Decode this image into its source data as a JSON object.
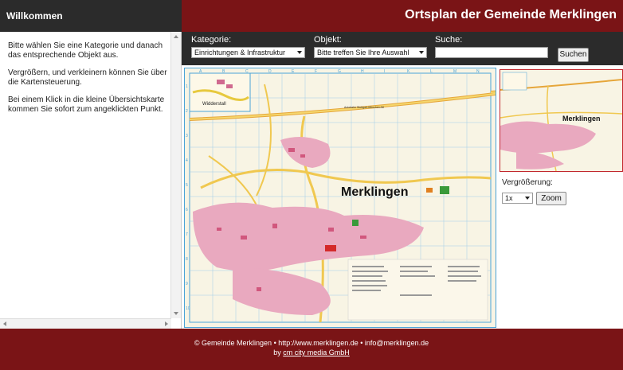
{
  "left_header": {
    "title": "Willkommen"
  },
  "top_header": {
    "title": "Ortsplan der Gemeinde Merklingen"
  },
  "instructions": [
    "Bitte wählen Sie eine Kategorie und danach das entsprechende Objekt aus.",
    "Vergrößern, und verkleinern können Sie über die Kartensteuerung.",
    "Bei einem Klick in die kleine Übersichtskarte kommen Sie sofort zum angeklickten Punkt."
  ],
  "toolbar": {
    "category_label": "Kategorie:",
    "category_value": "Einrichtungen & Infrastruktur",
    "object_label": "Objekt:",
    "object_value": "Bitte treffen Sie Ihre Auswahl",
    "search_label": "Suche:",
    "search_value": "",
    "search_button": "Suchen"
  },
  "map": {
    "town_label": "Merklingen",
    "inset_label": "Widderstall",
    "road_label": "Autobahn Stuttgart-München A8",
    "col_letters": [
      "A",
      "B",
      "C",
      "D",
      "E",
      "F",
      "G",
      "H",
      "I",
      "K",
      "L",
      "M",
      "N"
    ],
    "row_numbers": [
      "1",
      "2",
      "3",
      "4",
      "5",
      "6",
      "7",
      "8",
      "9",
      "10"
    ],
    "overview_label": "Merklingen"
  },
  "zoom": {
    "label": "Vergrößerung:",
    "value": "1x",
    "button": "Zoom"
  },
  "footer": {
    "line1": "© Gemeinde Merklingen • http://www.merklingen.de • info@merklingen.de",
    "line2_prefix": "by ",
    "line2_link": "cm city media GmbH"
  },
  "colors": {
    "header_dark": "#2b2b2b",
    "brand_red": "#7a1416",
    "map_bg": "#f8f4e4",
    "map_border": "#4aa3d8"
  }
}
